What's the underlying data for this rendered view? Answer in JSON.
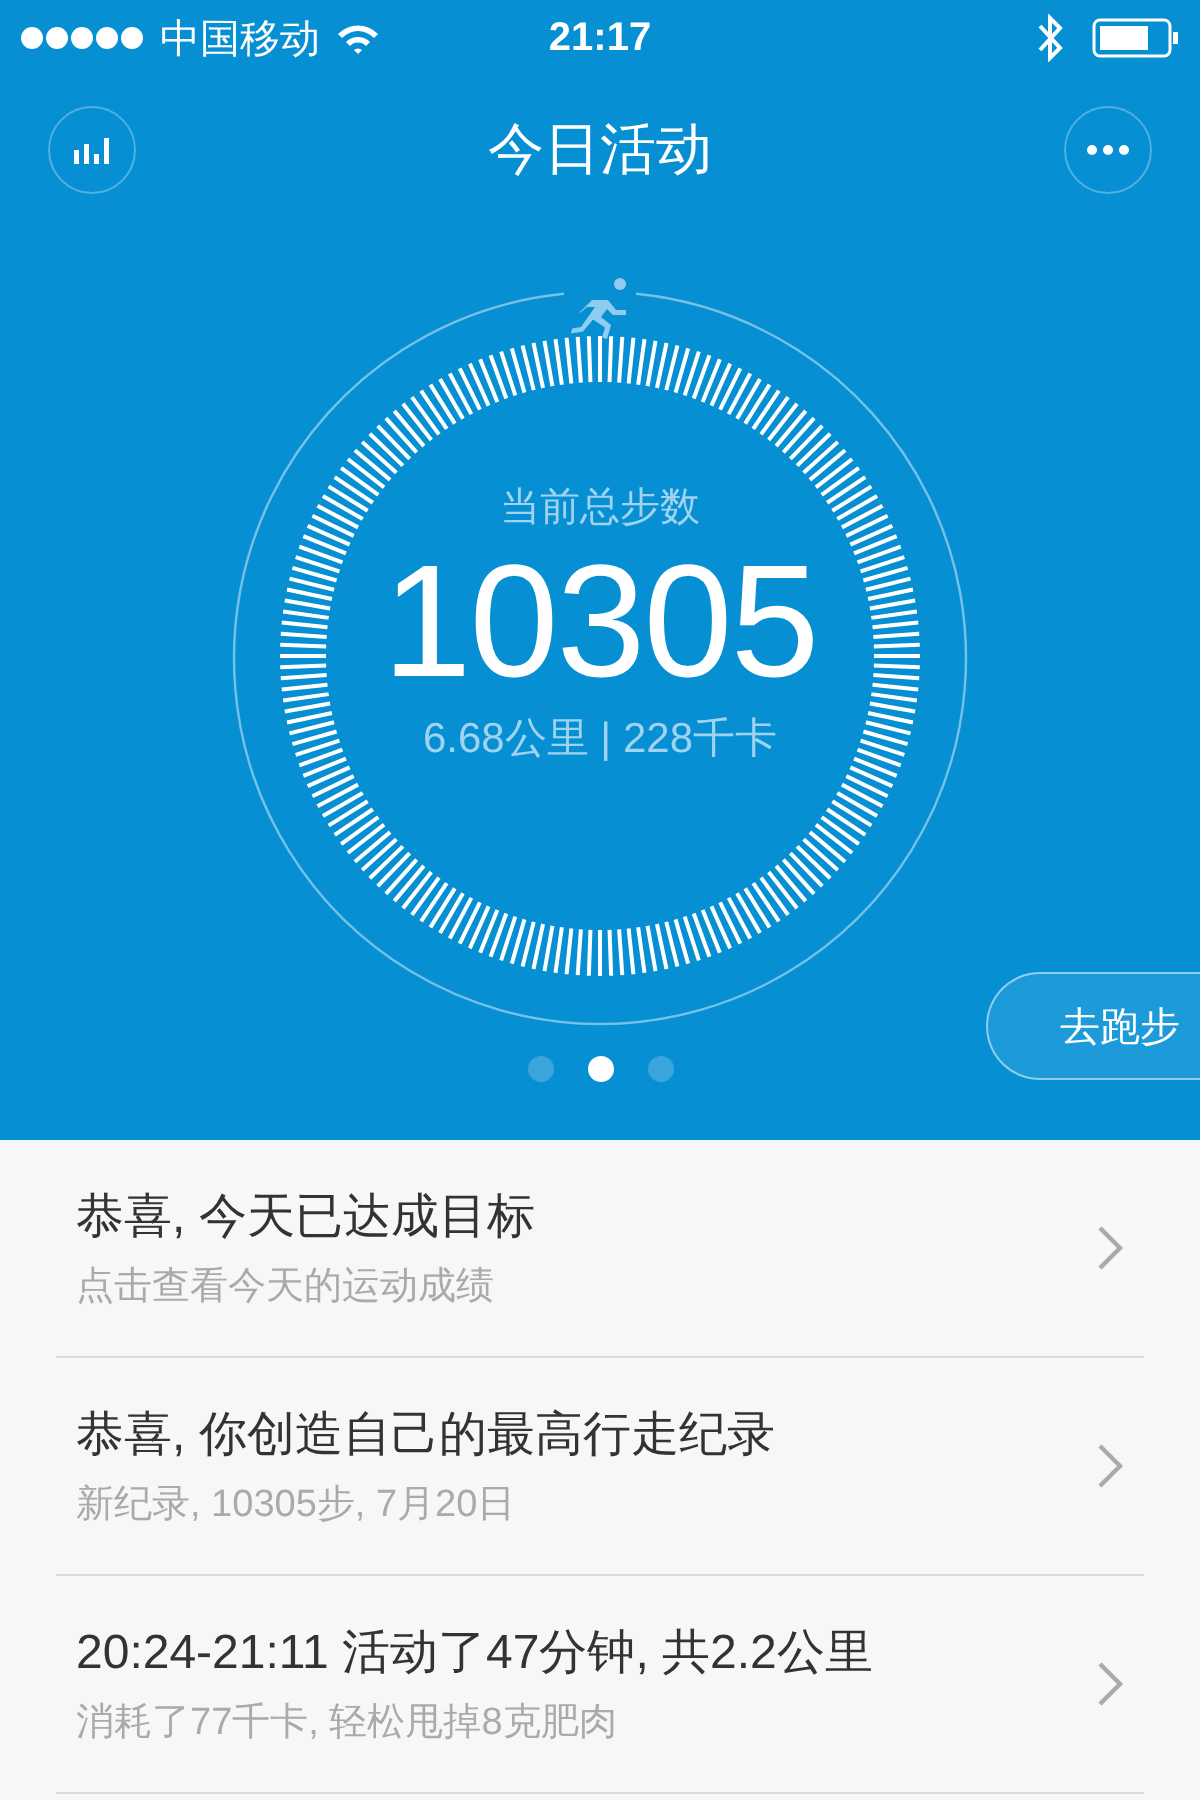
{
  "status_bar": {
    "carrier": "中国移动",
    "time": "21:17"
  },
  "nav": {
    "title": "今日活动"
  },
  "summary": {
    "label": "当前总步数",
    "steps": "10305",
    "detail": "6.68公里 | 228千卡"
  },
  "run_button": "去跑步",
  "pages": [
    {
      "selected": false
    },
    {
      "selected": true
    },
    {
      "selected": false
    }
  ],
  "cards": [
    {
      "title": "恭喜, 今天已达成目标",
      "subtitle": "点击查看今天的运动成绩"
    },
    {
      "title": "恭喜, 你创造自己的最高行走纪录",
      "subtitle": "新纪录, 10305步, 7月20日"
    },
    {
      "title": "20:24-21:11 活动了47分钟, 共2.2公里",
      "subtitle": "消耗了77千卡, 轻松甩掉8克肥肉"
    }
  ]
}
